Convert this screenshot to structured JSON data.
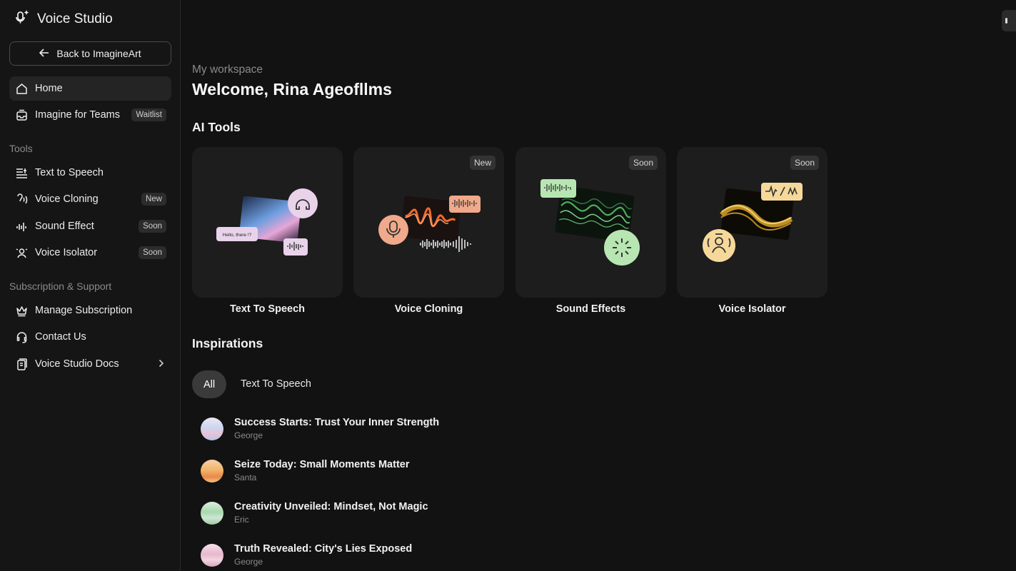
{
  "app": {
    "title": "Voice Studio"
  },
  "sidebar": {
    "back_label": "Back to ImagineArt",
    "home": {
      "label": "Home"
    },
    "teams": {
      "label": "Imagine for Teams",
      "badge": "Waitlist"
    },
    "tools_heading": "Tools",
    "tools": [
      {
        "label": "Text to Speech",
        "badge": ""
      },
      {
        "label": "Voice Cloning",
        "badge": "New"
      },
      {
        "label": "Sound Effect",
        "badge": "Soon"
      },
      {
        "label": "Voice Isolator",
        "badge": "Soon"
      }
    ],
    "support_heading": "Subscription & Support",
    "support": [
      {
        "label": "Manage Subscription"
      },
      {
        "label": "Contact Us"
      },
      {
        "label": "Voice Studio Docs"
      }
    ]
  },
  "main": {
    "breadcrumb": "My workspace",
    "welcome": "Welcome, Rina Ageofllms",
    "ai_tools_heading": "AI Tools",
    "tools": [
      {
        "name": "Text To Speech",
        "badge": "",
        "bubble_text": "Hello, there !?"
      },
      {
        "name": "Voice Cloning",
        "badge": "New"
      },
      {
        "name": "Sound Effects",
        "badge": "Soon"
      },
      {
        "name": "Voice Isolator",
        "badge": "Soon"
      }
    ],
    "inspirations_heading": "Inspirations",
    "filters": {
      "all": "All",
      "tts": "Text To Speech"
    },
    "inspirations": [
      {
        "title": "Success Starts: Trust Your Inner Strength",
        "voice": "George"
      },
      {
        "title": "Seize Today: Small Moments Matter",
        "voice": "Santa"
      },
      {
        "title": "Creativity Unveiled: Mindset, Not Magic",
        "voice": "Eric"
      },
      {
        "title": "Truth Revealed: City's Lies Exposed",
        "voice": "George"
      }
    ]
  },
  "colors": {
    "background": "#121212",
    "sidebar": "#151515",
    "card": "#1d1d1d",
    "accent_purple": "#d9c8ea",
    "accent_orange": "#f0a98a",
    "accent_green": "#b8e6b3",
    "accent_yellow": "#f6d99a"
  }
}
